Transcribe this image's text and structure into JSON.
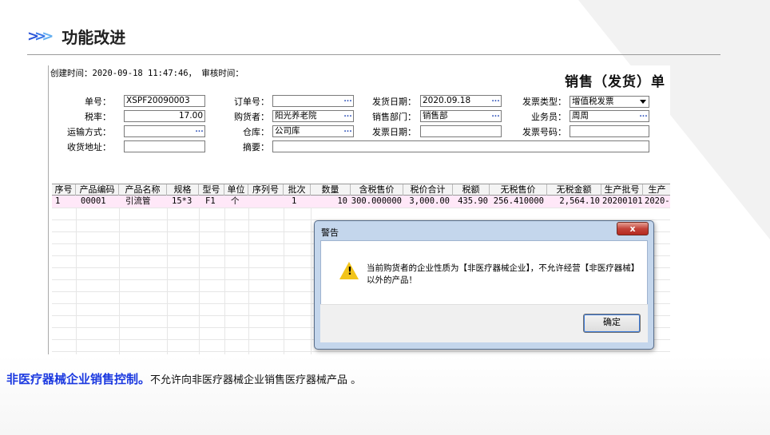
{
  "slide": {
    "title": "功能改进",
    "caption_bold": "非医疗器械企业销售控制。",
    "caption_text": "不允许向非医疗器械企业销售医疗器械产品 。"
  },
  "form": {
    "meta": "创建时间：2020-09-18 11:47:46， 审核时间：",
    "title": "销售（发货）单",
    "fields": {
      "order_no_label": "单号：",
      "order_no": "XSPF20090003",
      "tax_rate_label": "税率：",
      "tax_rate": "17.00",
      "ship_method_label": "运输方式：",
      "ship_method": "",
      "recv_addr_label": "收货地址：",
      "recv_addr": "",
      "po_no_label": "订单号：",
      "po_no": "",
      "buyer_label": "购货者：",
      "buyer": "阳光养老院",
      "warehouse_label": "仓库：",
      "warehouse": "公司库",
      "summary_label": "摘要：",
      "summary": "",
      "ship_date_label": "发货日期：",
      "ship_date": "2020.09.18",
      "sales_dept_label": "销售部门：",
      "sales_dept": "销售部",
      "invoice_date_label": "发票日期：",
      "invoice_date": "",
      "invoice_type_label": "发票类型：",
      "invoice_type": "增值税发票",
      "clerk_label": "业务员：",
      "clerk": "周周",
      "invoice_no_label": "发票号码：",
      "invoice_no": ""
    },
    "grid": {
      "headers": [
        "序号",
        "产品编码",
        "产品名称",
        "规格",
        "型号",
        "单位",
        "序列号",
        "批次",
        "数量",
        "含税售价",
        "税价合计",
        "税额",
        "无税售价",
        "无税金额",
        "生产批号",
        "生产"
      ],
      "row": [
        "1",
        "00001",
        "引流管",
        "15*3",
        "F1",
        "个",
        "",
        "1",
        "10",
        "300.000000",
        "3,000.00",
        "435.90",
        "256.410000",
        "2,564.10",
        "20200101",
        "2020-"
      ]
    }
  },
  "dialog": {
    "title": "警告",
    "close": "x",
    "message": "当前购货者的企业性质为【非医疗器械企业】，不允许经营【非医疗器械】以外的产品！",
    "ok": "确定"
  }
}
